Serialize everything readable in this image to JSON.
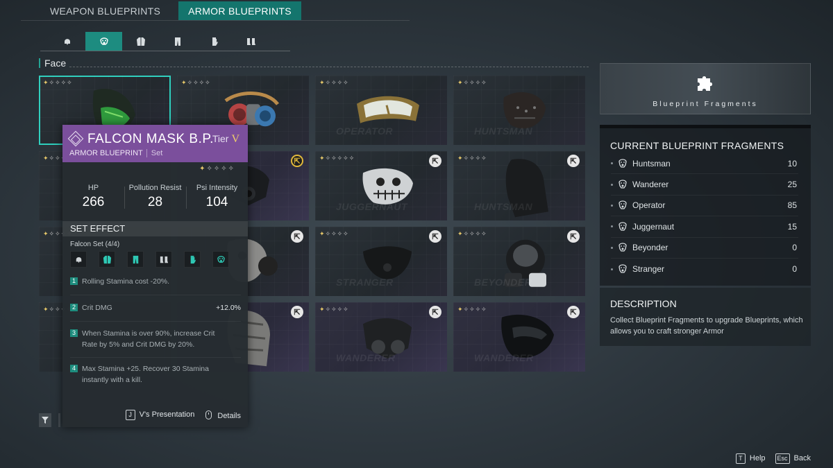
{
  "top_tabs": [
    {
      "label": "WEAPON BLUEPRINTS",
      "active": false
    },
    {
      "label": "ARMOR BLUEPRINTS",
      "active": true
    }
  ],
  "category_tabs": [
    {
      "icon": "helmet-icon",
      "active": false
    },
    {
      "icon": "gas-mask-icon",
      "active": true
    },
    {
      "icon": "jacket-icon",
      "active": false
    },
    {
      "icon": "pants-icon",
      "active": false
    },
    {
      "icon": "glove-icon",
      "active": false
    },
    {
      "icon": "boots-icon",
      "active": false
    }
  ],
  "section_label": "Face",
  "cards": [
    {
      "watermark": "",
      "stars_filled": 1,
      "stars_total": 5,
      "badge": "",
      "selected": true,
      "purple": false,
      "item": "green-mask"
    },
    {
      "watermark": "",
      "stars_filled": 1,
      "stars_total": 5,
      "badge": "",
      "selected": false,
      "purple": false,
      "item": "respirator"
    },
    {
      "watermark": "OPERATOR",
      "stars_filled": 1,
      "stars_total": 5,
      "badge": "",
      "selected": false,
      "purple": false,
      "item": "goggles"
    },
    {
      "watermark": "HUNTSMAN",
      "stars_filled": 1,
      "stars_total": 5,
      "badge": "",
      "selected": false,
      "purple": false,
      "item": "leather-mask"
    },
    {
      "watermark": "",
      "stars_filled": 1,
      "stars_total": 5,
      "badge": "",
      "selected": false,
      "purple": false,
      "item": "none"
    },
    {
      "watermark": "",
      "stars_filled": 0,
      "stars_total": 0,
      "badge": "gold",
      "selected": false,
      "purple": true,
      "item": "gas-mask"
    },
    {
      "watermark": "JUGGERNAUT",
      "stars_filled": 1,
      "stars_total": 6,
      "badge": "white",
      "selected": false,
      "purple": false,
      "item": "skull-mask"
    },
    {
      "watermark": "HUNTSMAN",
      "stars_filled": 1,
      "stars_total": 5,
      "badge": "white",
      "selected": false,
      "purple": false,
      "item": "balaclava"
    },
    {
      "watermark": "",
      "stars_filled": 1,
      "stars_total": 5,
      "badge": "",
      "selected": false,
      "purple": false,
      "item": "none"
    },
    {
      "watermark": "",
      "stars_filled": 0,
      "stars_total": 0,
      "badge": "white",
      "selected": false,
      "purple": false,
      "item": "skull-respirator"
    },
    {
      "watermark": "STRANGER",
      "stars_filled": 1,
      "stars_total": 5,
      "badge": "white",
      "selected": false,
      "purple": false,
      "item": "half-mask"
    },
    {
      "watermark": "BEYONDER",
      "stars_filled": 1,
      "stars_total": 5,
      "badge": "white",
      "selected": false,
      "purple": false,
      "item": "full-gas-mask"
    },
    {
      "watermark": "",
      "stars_filled": 1,
      "stars_total": 5,
      "badge": "",
      "selected": false,
      "purple": false,
      "item": "none"
    },
    {
      "watermark": "",
      "stars_filled": 0,
      "stars_total": 0,
      "badge": "white",
      "selected": false,
      "purple": true,
      "item": "cloth-wrap"
    },
    {
      "watermark": "WANDERER",
      "stars_filled": 1,
      "stars_total": 5,
      "badge": "white",
      "selected": false,
      "purple": true,
      "item": "gas-mask-2"
    },
    {
      "watermark": "WANDERER",
      "stars_filled": 1,
      "stars_total": 5,
      "badge": "white",
      "selected": false,
      "purple": true,
      "item": "visor-mask"
    }
  ],
  "tooltip": {
    "title": "FALCON MASK B.P.",
    "tier_label": "Tier",
    "tier_value": "V",
    "type": "ARMOR BLUEPRINT",
    "tag": "Set",
    "stars_filled": 1,
    "stars_total": 5,
    "stats": [
      {
        "label": "HP",
        "value": "266"
      },
      {
        "label": "Pollution Resist",
        "value": "28"
      },
      {
        "label": "Psi Intensity",
        "value": "104"
      }
    ],
    "set_effect_header": "SET EFFECT",
    "set_name": "Falcon Set (4/4)",
    "set_pieces": [
      "helmet-icon",
      "jacket-icon",
      "pants-icon",
      "boots-icon",
      "glove-icon",
      "gas-mask-icon"
    ],
    "set_pieces_equipped": [
      false,
      true,
      true,
      false,
      true,
      true
    ],
    "effects": [
      {
        "num": "1",
        "text": "Rolling Stamina cost -20%.",
        "value": ""
      },
      {
        "num": "2",
        "text": "Crit DMG",
        "value": "+12.0%"
      },
      {
        "num": "3",
        "text": "When Stamina is over 90%, increase Crit Rate by 5% and Crit DMG by 20%.",
        "value": ""
      },
      {
        "num": "4",
        "text": "Max Stamina +25. Recover 30 Stamina instantly with a kill.",
        "value": ""
      }
    ],
    "footer": [
      {
        "key": "J",
        "label": "V's Presentation"
      },
      {
        "key": "mouse",
        "label": "Details"
      }
    ]
  },
  "fragments": {
    "banner_title": "Blueprint Fragments",
    "header": "CURRENT BLUEPRINT FRAGMENTS",
    "rows": [
      {
        "name": "Huntsman",
        "value": "10"
      },
      {
        "name": "Wanderer",
        "value": "25"
      },
      {
        "name": "Operator",
        "value": "85"
      },
      {
        "name": "Juggernaut",
        "value": "15"
      },
      {
        "name": "Beyonder",
        "value": "0"
      },
      {
        "name": "Stranger",
        "value": "0"
      }
    ]
  },
  "description": {
    "header": "DESCRIPTION",
    "text": "Collect Blueprint Fragments to upgrade Blueprints, which allows you to craft stronger Armor"
  },
  "bottom_keys": [
    {
      "key": "T",
      "label": "Help"
    },
    {
      "key": "Esc",
      "label": "Back"
    }
  ],
  "colors": {
    "accent": "#1d8c80",
    "tooltip_header": "#7b4f9c",
    "tier_gold": "#f0cf6a",
    "star_gold": "#e8c96a"
  }
}
